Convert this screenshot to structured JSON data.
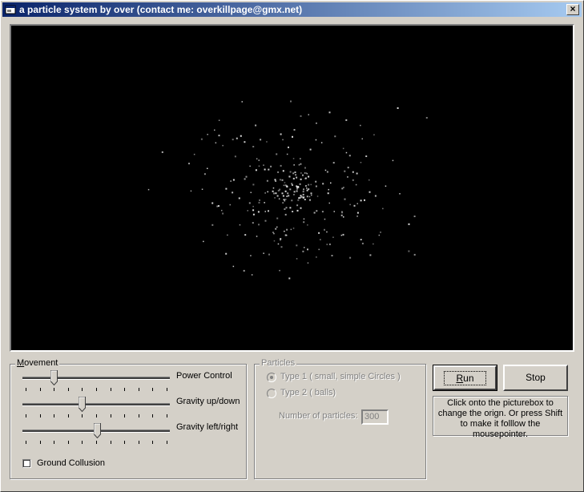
{
  "window": {
    "title": "a particle system by over (contact me: overkillpage@gmx.net)",
    "close_glyph": "×",
    "background_color": "#d4d0c8",
    "canvas_background": "#000000",
    "particle_color": "#e0e0e0"
  },
  "movement": {
    "legend_first": "M",
    "legend_rest": "ovement",
    "sliders": [
      {
        "label": "Power Control",
        "value_fraction": 0.22
      },
      {
        "label": "Gravity up/down",
        "value_fraction": 0.41
      },
      {
        "label": "Gravity left/right",
        "value_fraction": 0.51
      }
    ],
    "ground_collision_label": "Ground Collusion",
    "ground_collision_checked": false
  },
  "particles": {
    "legend": "Particles",
    "type1_label": "Type 1 ( small, simple Circles )",
    "type2_label": "Type 2 ( balls)",
    "count_label": "Number of particles:",
    "count_value": "300"
  },
  "buttons": {
    "run_first": "R",
    "run_rest": "un",
    "stop": "Stop"
  },
  "info_text": "Click onto the picturebox to change the orign. Or press Shift to make it folllow the mousepointer.",
  "icons": {
    "app": "app-window-icon",
    "close": "close-icon"
  }
}
